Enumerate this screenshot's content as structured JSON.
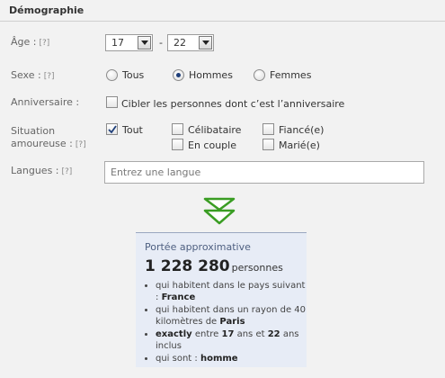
{
  "section": {
    "title": "Démographie"
  },
  "age": {
    "label": "Âge :",
    "help": "[?]",
    "min": "17",
    "max": "22",
    "separator": "-"
  },
  "sex": {
    "label": "Sexe :",
    "help": "[?]",
    "options": [
      "Tous",
      "Hommes",
      "Femmes"
    ],
    "selected": "Hommes"
  },
  "birthday": {
    "label": "Anniversaire :",
    "checkbox_label": "Cibler les personnes dont c’est l’anniversaire",
    "checked": false
  },
  "relationship": {
    "label_line1": "Situation",
    "label_line2": "amoureuse :",
    "help": "[?]",
    "options": [
      {
        "label": "Tout",
        "checked": true
      },
      {
        "label": "Célibataire",
        "checked": false
      },
      {
        "label": "Fiancé(e)",
        "checked": false
      },
      {
        "label": "En couple",
        "checked": false
      },
      {
        "label": "Marié(e)",
        "checked": false
      }
    ]
  },
  "languages": {
    "label": "Langues :",
    "help": "[?]",
    "placeholder": "Entrez une langue",
    "value": ""
  },
  "reach": {
    "title": "Portée approximative",
    "count": "1 228 280",
    "unit": "personnes",
    "criteria": {
      "country_prefix": "qui habitent dans le pays suivant :",
      "country": "France",
      "radius_prefix": "qui habitent dans un rayon de 40 kilomètres de",
      "city": "Paris",
      "age_exact": "exactly",
      "age_between": "entre",
      "age_min": "17",
      "age_and": "ans et",
      "age_max": "22",
      "age_suffix": "ans inclus",
      "gender_prefix": "qui sont :",
      "gender": "homme"
    }
  },
  "colors": {
    "background": "#f2f2f2",
    "reach_panel": "#e7ecf6",
    "arrow_green": "#3a9d23",
    "radio_dot": "#1f3f7a"
  }
}
